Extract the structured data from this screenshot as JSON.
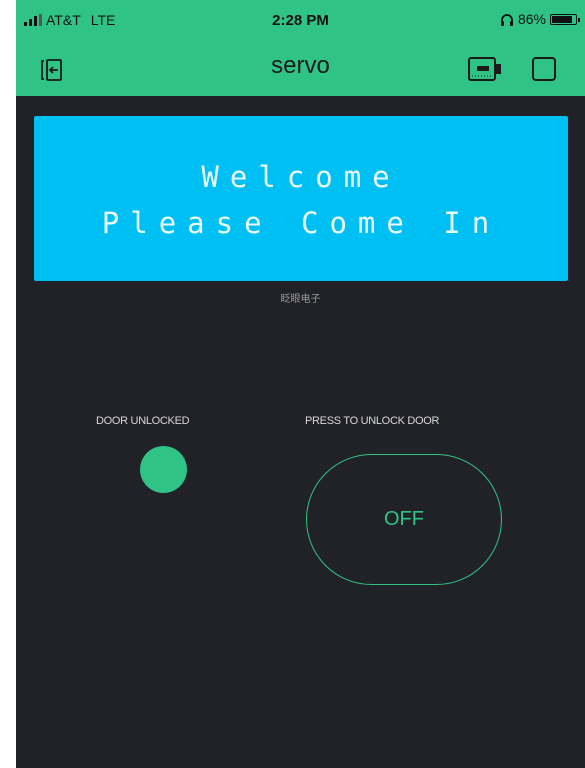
{
  "status_bar": {
    "carrier": "AT&T",
    "network": "LTE",
    "time": "2:28 PM",
    "battery_percent": "86%",
    "battery_level": 0.86
  },
  "header": {
    "title": "servo"
  },
  "lcd": {
    "line1": "Welcome",
    "line2": "Please Come In",
    "caption": "眨眼电子"
  },
  "led": {
    "label": "DOOR UNLOCKED",
    "state": "on"
  },
  "button": {
    "label": "PRESS TO UNLOCK DOOR",
    "value": "OFF"
  },
  "colors": {
    "accent": "#2fc486",
    "background": "#212227",
    "lcd_background": "#00bff3"
  }
}
